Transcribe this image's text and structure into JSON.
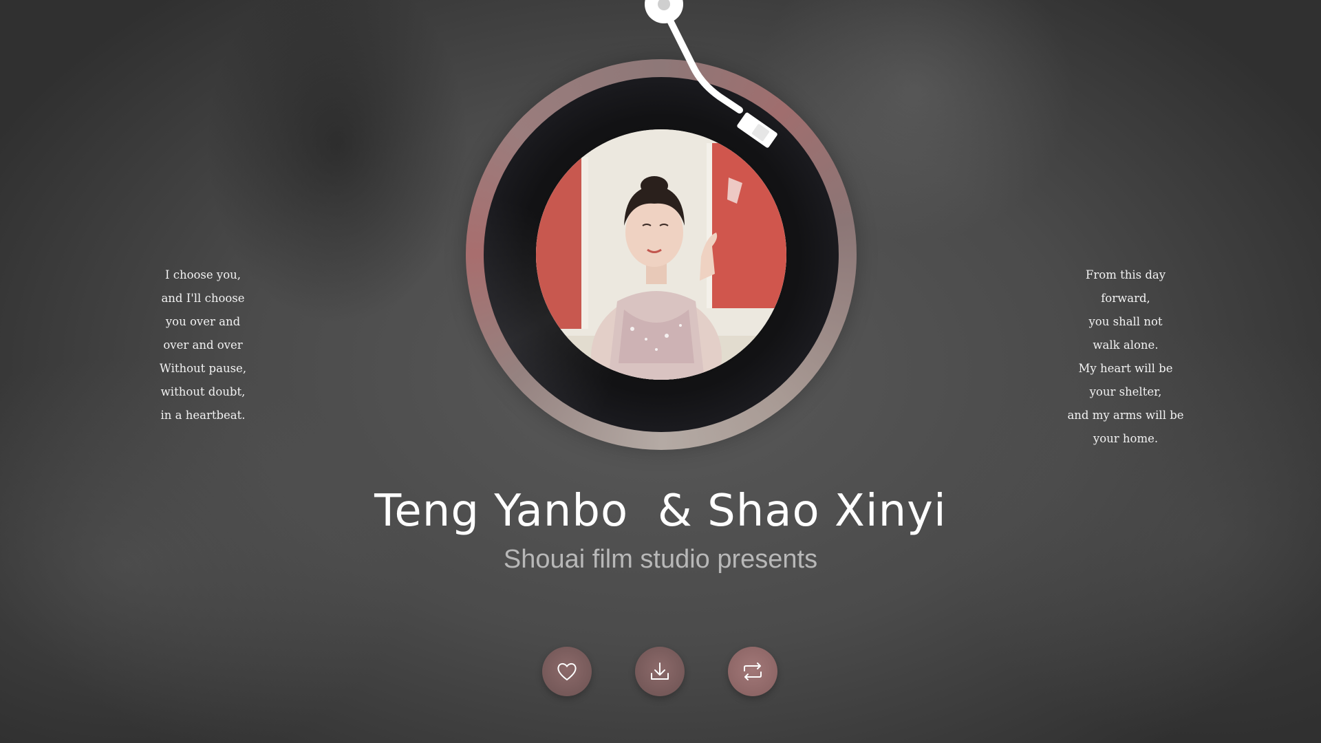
{
  "poem_left": [
    "I choose you,",
    "and I'll choose",
    "you over and",
    "over and over",
    "Without pause,",
    "without doubt,",
    "in a heartbeat."
  ],
  "poem_right": [
    "From this day",
    "forward,",
    "you shall not",
    "walk alone.",
    "My heart will be",
    "your shelter,",
    "and my arms will be",
    "your home."
  ],
  "title": "Teng Yanbo  & Shao Xinyi",
  "subtitle": "Shouai film studio presents",
  "controls": {
    "like_icon": "heart-icon",
    "download_icon": "download-icon",
    "repeat_icon": "repeat-icon"
  },
  "colors": {
    "control_bg": "#7a5d5d",
    "title": "#ffffff",
    "subtitle": "#b8b8b8"
  }
}
